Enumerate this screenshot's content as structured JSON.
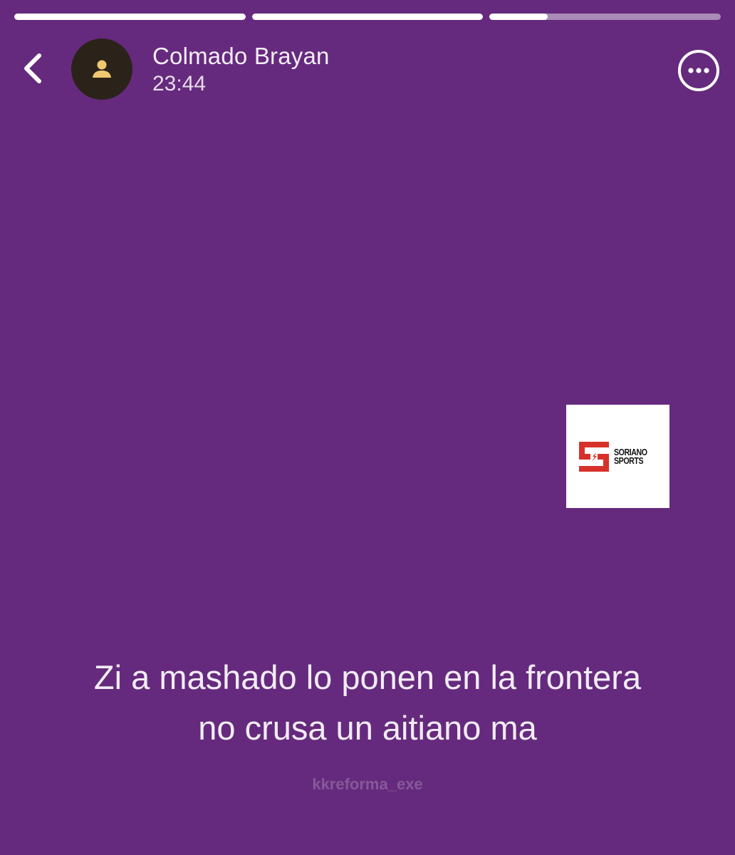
{
  "progress": {
    "segments": [
      {
        "label": "story-1",
        "fill": 1.0
      },
      {
        "label": "story-2",
        "fill": 1.0
      },
      {
        "label": "story-3",
        "fill": 0.25
      }
    ]
  },
  "header": {
    "user_name": "Colmado Brayan",
    "time": "23:44",
    "back_icon": "chevron-left-icon",
    "avatar_icon": "user-icon",
    "more_icon": "more-horizontal-icon"
  },
  "sticker": {
    "brand_line1": "SORIANO",
    "brand_line2": "SPORTS",
    "brand_color": "#d7312b"
  },
  "caption": {
    "line1": "Zi a mashado lo ponen en la frontera",
    "line2": "no crusa un aitiano ma"
  },
  "watermark": "kkreforma_exe",
  "colors": {
    "background": "#652a7d",
    "avatar_bg": "#2b2319",
    "avatar_icon": "#f0c870"
  }
}
